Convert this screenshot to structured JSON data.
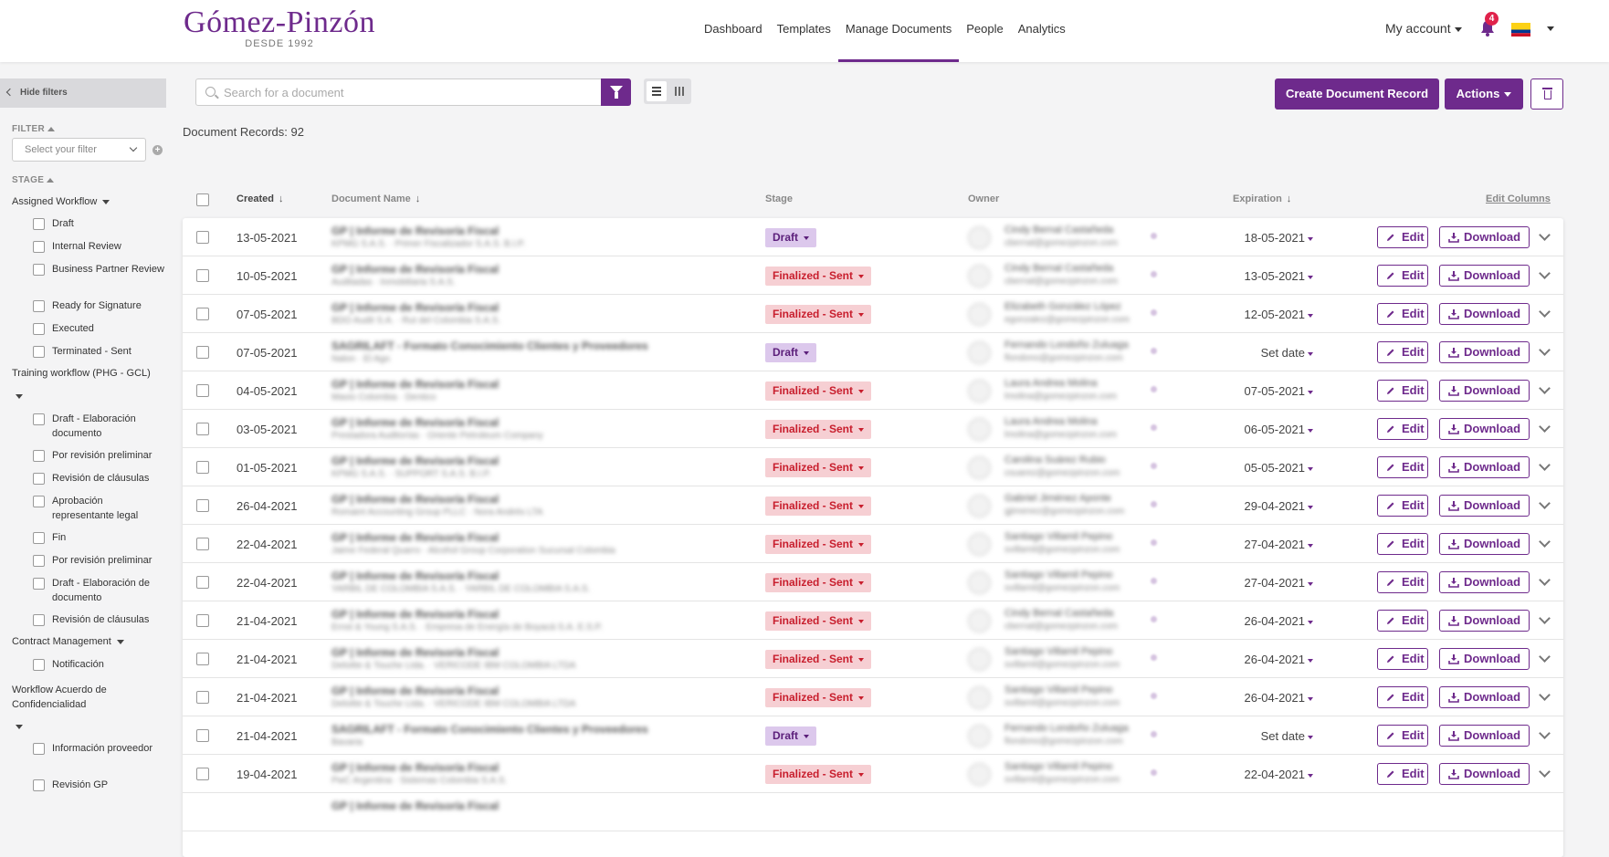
{
  "brand": {
    "name": "Gómez-Pinzón",
    "tagline": "DESDE 1992",
    "accent": "#6e2a8c"
  },
  "nav": [
    {
      "label": "Dashboard"
    },
    {
      "label": "Templates"
    },
    {
      "label": "Manage Documents",
      "active": true
    },
    {
      "label": "People"
    },
    {
      "label": "Analytics"
    }
  ],
  "account": {
    "label": "My account",
    "notifications": "4",
    "flag": "colombia-flag-icon"
  },
  "sidebar": {
    "hide_filters": "Hide filters",
    "filter_heading": "FILTER",
    "filter_placeholder": "Select your filter",
    "stage_heading": "STAGE",
    "groups": [
      {
        "title": "Assigned Workflow",
        "items": [
          "Draft",
          "Internal Review",
          "Business Partner Review",
          "Ready for Signature",
          "Executed",
          "Terminated - Sent"
        ]
      },
      {
        "title": "Training workflow (PHG - GCL)",
        "items": [
          "Draft - Elaboración documento",
          "Por revisión preliminar",
          "Revisión de cláusulas",
          "Aprobación representante legal",
          "Fin",
          "Por revisión preliminar",
          "Draft - Elaboración de documento",
          "Revisión de cláusulas"
        ]
      },
      {
        "title": "Contract Management",
        "items": [
          "Notificación"
        ]
      },
      {
        "title": "Workflow Acuerdo de Confidencialidad",
        "items": [
          "Información proveedor",
          "Revisión GP"
        ]
      }
    ]
  },
  "toolbar": {
    "search_placeholder": "Search for a document",
    "create_label": "Create Document Record",
    "actions_label": "Actions"
  },
  "record_count": "Document Records: 92",
  "columns": {
    "created": "Created",
    "document_name": "Document Name",
    "stage": "Stage",
    "owner": "Owner",
    "expiration": "Expiration",
    "edit_columns": "Edit Columns"
  },
  "row_actions": {
    "edit": "Edit",
    "download": "Download"
  },
  "rows": [
    {
      "created": "13-05-2021",
      "doc": "GP | Informe de Revisoría Fiscal",
      "sub": "KPMG S.A.S. · Primer Fiscalizador S.A.S. B.I.P.",
      "stage": "Draft",
      "kind": "draft",
      "owner": "Cindy Bernal Castañeda",
      "email": "cbernal@gomezpinzon.com",
      "exp": "18-05-2021"
    },
    {
      "created": "10-05-2021",
      "doc": "GP | Informe de Revisoría Fiscal",
      "sub": "Auditadas · Inmobiliaria S.A.S.",
      "stage": "Finalized - Sent",
      "kind": "final",
      "owner": "Cindy Bernal Castañeda",
      "email": "cbernal@gomezpinzon.com",
      "exp": "13-05-2021"
    },
    {
      "created": "07-05-2021",
      "doc": "GP | Informe de Revisoría Fiscal",
      "sub": "BDO Audit S.A. · Rut del Colombia S.A.S.",
      "stage": "Finalized - Sent",
      "kind": "final",
      "owner": "Elizabeth González López",
      "email": "egonzalez@gomezpinzon.com",
      "exp": "12-05-2021"
    },
    {
      "created": "07-05-2021",
      "doc": "SAGRILAFT - Formato Conocimiento Clientes y Proveedores",
      "sub": "Nalon · El Ago",
      "stage": "Draft",
      "kind": "draft",
      "owner": "Fernando Londoño Zuluaga",
      "email": "flondono@gomezpinzon.com",
      "exp": "Set date"
    },
    {
      "created": "04-05-2021",
      "doc": "GP | Informe de Revisoría Fiscal",
      "sub": "Mavio Colombia · Dentico",
      "stage": "Finalized - Sent",
      "kind": "final",
      "owner": "Laura Andrea Molina",
      "email": "lmolina@gomezpinzon.com",
      "exp": "07-05-2021"
    },
    {
      "created": "03-05-2021",
      "doc": "GP | Informe de Revisoría Fiscal",
      "sub": "Prestadora Auditorías · Oriente Petroleum Company",
      "stage": "Finalized - Sent",
      "kind": "final",
      "owner": "Laura Andrea Molina",
      "email": "lmolina@gomezpinzon.com",
      "exp": "06-05-2021"
    },
    {
      "created": "01-05-2021",
      "doc": "GP | Informe de Revisoría Fiscal",
      "sub": "KPMG S.A.S. · SUPPORT S.A.S. B.I.P.",
      "stage": "Finalized - Sent",
      "kind": "final",
      "owner": "Carolina Suárez Rubio",
      "email": "csuarez@gomezpinzon.com",
      "exp": "05-05-2021"
    },
    {
      "created": "26-04-2021",
      "doc": "GP | Informe de Revisoría Fiscal",
      "sub": "Romaint Accounting Group PLLC · Nora Andrés LTA",
      "stage": "Finalized - Sent",
      "kind": "final",
      "owner": "Gabriel Jiménez Aponte",
      "email": "gjimenez@gomezpinzon.com",
      "exp": "29-04-2021"
    },
    {
      "created": "22-04-2021",
      "doc": "GP | Informe de Revisoría Fiscal",
      "sub": "Jaime Federal Quarro · Alcohol Group Corporation Sucursal Colombia",
      "stage": "Finalized - Sent",
      "kind": "final",
      "owner": "Santiago Villamil Pepino",
      "email": "svillamil@gomezpinzon.com",
      "exp": "27-04-2021"
    },
    {
      "created": "22-04-2021",
      "doc": "GP | Informe de Revisoría Fiscal",
      "sub": "YARBIL DE COLOMBIA S.A.S. · YARBIL DE COLOMBIA S.A.S.",
      "stage": "Finalized - Sent",
      "kind": "final",
      "owner": "Santiago Villamil Pepino",
      "email": "svillamil@gomezpinzon.com",
      "exp": "27-04-2021"
    },
    {
      "created": "21-04-2021",
      "doc": "GP | Informe de Revisoría Fiscal",
      "sub": "Ernst & Young S.A.S. · Empresa de Energía de Boyacá S.A. E.S.P.",
      "stage": "Finalized - Sent",
      "kind": "final",
      "owner": "Cindy Bernal Castañeda",
      "email": "cbernal@gomezpinzon.com",
      "exp": "26-04-2021"
    },
    {
      "created": "21-04-2021",
      "doc": "GP | Informe de Revisoría Fiscal",
      "sub": "Deloitte & Touche Ltda. · VERICODE IBM COLOMBIA LTDA",
      "stage": "Finalized - Sent",
      "kind": "final",
      "owner": "Santiago Villamil Pepino",
      "email": "svillamil@gomezpinzon.com",
      "exp": "26-04-2021"
    },
    {
      "created": "21-04-2021",
      "doc": "GP | Informe de Revisoría Fiscal",
      "sub": "Deloitte & Touche Ltda. · VERICODE IBM COLOMBIA LTDA",
      "stage": "Finalized - Sent",
      "kind": "final",
      "owner": "Santiago Villamil Pepino",
      "email": "svillamil@gomezpinzon.com",
      "exp": "26-04-2021"
    },
    {
      "created": "21-04-2021",
      "doc": "SAGRILAFT - Formato Conocimiento Clientes y Proveedores",
      "sub": "Bavaria",
      "stage": "Draft",
      "kind": "draft",
      "owner": "Fernando Londoño Zuluaga",
      "email": "flondono@gomezpinzon.com",
      "exp": "Set date"
    },
    {
      "created": "19-04-2021",
      "doc": "GP | Informe de Revisoría Fiscal",
      "sub": "PwC Argentina · Sistemas Colombia S.A.S.",
      "stage": "Finalized - Sent",
      "kind": "final",
      "owner": "Santiago Villamil Pepino",
      "email": "svillamil@gomezpinzon.com",
      "exp": "22-04-2021"
    },
    {
      "created": "",
      "doc": "GP | Informe de Revisoría Fiscal",
      "sub": "",
      "stage": "",
      "kind": "",
      "owner": "",
      "email": "",
      "exp": ""
    }
  ]
}
